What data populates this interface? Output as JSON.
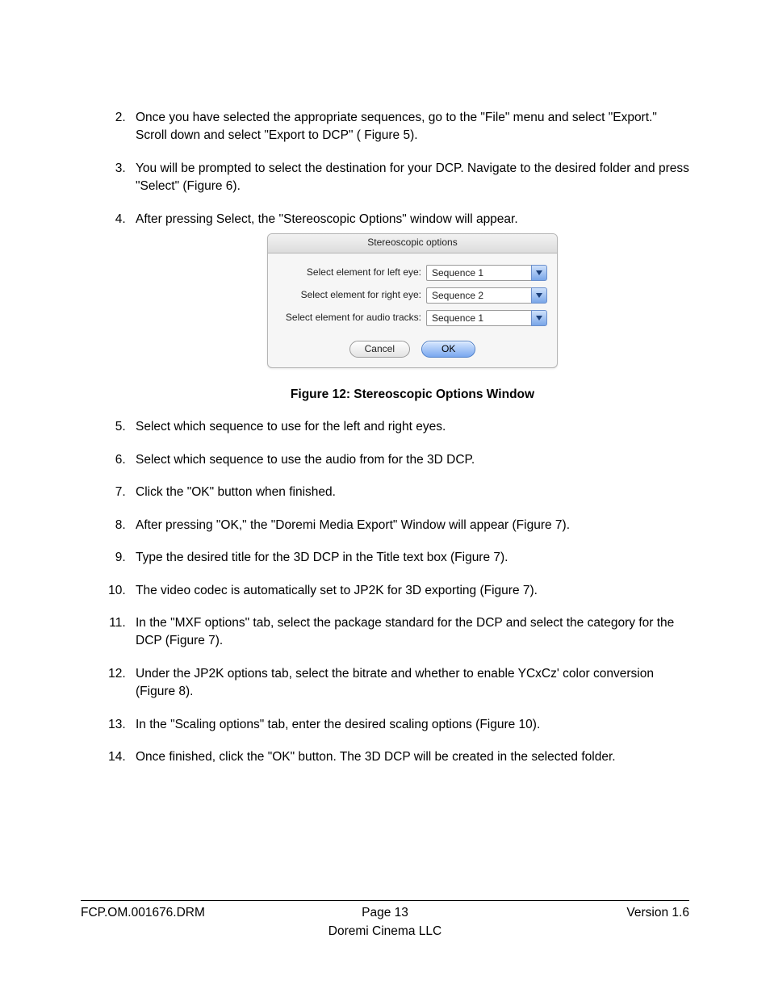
{
  "steps": {
    "start": 2,
    "s2": "Once you have selected the appropriate sequences, go to the \"File\" menu and select \"Export.\" Scroll down and select \"Export to DCP\" ( Figure 5).",
    "s3": "You will be prompted to select the destination for your DCP.  Navigate to the desired folder and press \"Select\"  (Figure 6).",
    "s4": "After pressing Select, the \"Stereoscopic Options\" window will appear.",
    "s5": "Select which sequence to use for the left and right eyes.",
    "s6": "Select which sequence to use the audio from for the 3D DCP.",
    "s7": "Click the \"OK\" button when finished.",
    "s8": "After pressing \"OK,\" the \"Doremi Media Export\" Window will appear (Figure 7).",
    "s9": "Type the desired title for the 3D DCP in the Title text box (Figure 7).",
    "s10": "The video codec is automatically set to JP2K for 3D exporting (Figure 7).",
    "s11": "In the \"MXF options\" tab, select the package standard for the DCP and select the category for the DCP (Figure 7).",
    "s12": "Under the JP2K options tab, select the bitrate and whether to enable YCxCz' color conversion (Figure 8).",
    "s13": "In the \"Scaling options\" tab, enter the desired scaling options (Figure 10).",
    "s14": "Once finished, click the \"OK\" button. The 3D DCP will be created in the selected folder."
  },
  "dialog": {
    "title": "Stereoscopic options",
    "rows": {
      "left": {
        "label": "Select element for left eye:",
        "value": "Sequence 1"
      },
      "right": {
        "label": "Select element for right eye:",
        "value": "Sequence 2"
      },
      "audio": {
        "label": "Select element for audio tracks:",
        "value": "Sequence 1"
      }
    },
    "buttons": {
      "cancel": "Cancel",
      "ok": "OK"
    }
  },
  "figure_caption": "Figure 12: Stereoscopic Options Window",
  "footer": {
    "doc_id": "FCP.OM.001676.DRM",
    "page": "Page 13",
    "version": "Version 1.6",
    "company": "Doremi Cinema LLC"
  }
}
